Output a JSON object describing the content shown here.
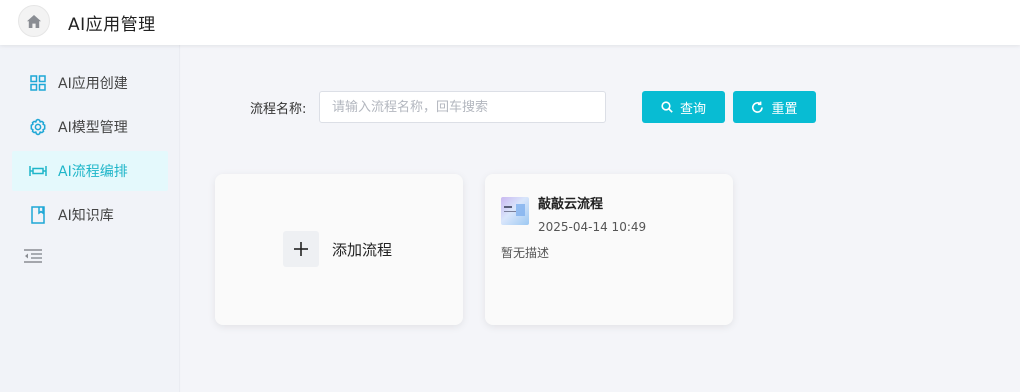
{
  "header": {
    "title": "AI应用管理",
    "home_icon": "home-icon"
  },
  "sidebar": {
    "items": [
      {
        "label": "AI应用创建",
        "icon": "grid-icon",
        "active": false
      },
      {
        "label": "AI模型管理",
        "icon": "gear-icon",
        "active": false
      },
      {
        "label": "AI流程编排",
        "icon": "flow-icon",
        "active": true
      },
      {
        "label": "AI知识库",
        "icon": "book-icon",
        "active": false
      }
    ],
    "collapse_icon": "collapse-menu-icon"
  },
  "filter": {
    "label": "流程名称:",
    "placeholder": "请输入流程名称，回车搜索",
    "value": "",
    "query_label": "查询",
    "reset_label": "重置"
  },
  "cards": {
    "add": {
      "label": "添加流程"
    },
    "flows": [
      {
        "name": "敲敲云流程",
        "time": "2025-04-14 10:49",
        "description": "暂无描述"
      }
    ]
  },
  "colors": {
    "accent": "#08bcd3",
    "active_bg": "#e4f9fc",
    "active_text": "#1fb6c9"
  }
}
